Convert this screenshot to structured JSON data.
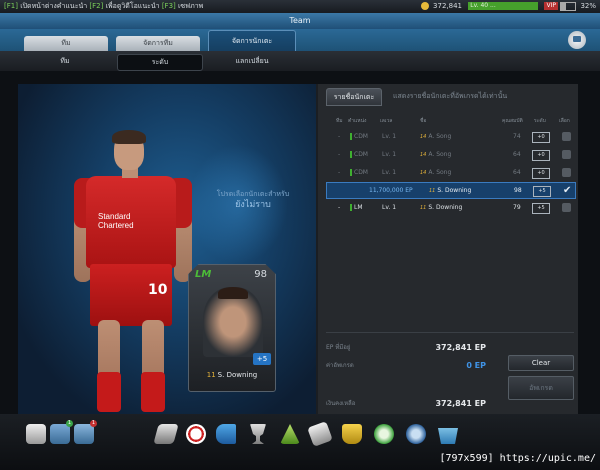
{
  "topbar": {
    "left_prefix_1": "[F1]",
    "left_text_1": "เปิดหน้าต่างคำแนะนำ",
    "left_prefix_2": "[F2]",
    "left_text_2": "เพื่อดูวิดีโอแนะนำ",
    "left_prefix_3": "[F3]",
    "left_text_3": "เซฟภาพ",
    "coins": "372,841",
    "level_text": "Lv. 40 ...",
    "vip": "VIP",
    "battery": "32%"
  },
  "window": {
    "title": "Team"
  },
  "main_tabs": [
    {
      "label": "ทีม"
    },
    {
      "label": "จัดการทีม"
    },
    {
      "label": "จัดการนักเตะ"
    }
  ],
  "sub_tabs": [
    {
      "label": "ทีม"
    },
    {
      "label": "ระดับ"
    },
    {
      "label": "แลกเปลี่ยน"
    }
  ],
  "empty_slot": {
    "line1": "โปรดเลือกนักเตะสำหรับ",
    "line2": "ยังไม่ราบ"
  },
  "player": {
    "sponsor_line1": "Standard",
    "sponsor_line2": "Chartered",
    "shorts_number": "10"
  },
  "card": {
    "position": "LM",
    "overall": "98",
    "plus": "+5",
    "season": "11",
    "name": "S. Downing"
  },
  "panel": {
    "tab_active": "รายชื่อนักเตะ",
    "tab_hint": "แสดงรายชื่อนักเตะที่อัพเกรดได้เท่านั้น",
    "columns": [
      "ทีม",
      "ตำแหน่ง",
      "เลเวล",
      "ชื่อ",
      "คุณสมบัติ",
      "ระดับ",
      "เลือก"
    ],
    "rows": [
      {
        "team": "-",
        "pos": "CDM",
        "level": "Lv. 1",
        "season": "14",
        "name": "A. Song",
        "ovr": "74",
        "plus": "+0",
        "checked": false,
        "state": "dim"
      },
      {
        "team": "-",
        "pos": "CDM",
        "level": "Lv. 1",
        "season": "14",
        "name": "A. Song",
        "ovr": "64",
        "plus": "+0",
        "checked": false,
        "state": "dim"
      },
      {
        "team": "-",
        "pos": "CDM",
        "level": "Lv. 1",
        "season": "14",
        "name": "A. Song",
        "ovr": "64",
        "plus": "+0",
        "checked": false,
        "state": "dim"
      },
      {
        "price": "11,700,000 EP",
        "season": "11",
        "name": "S. Downing",
        "ovr": "98",
        "plus": "+5",
        "checked": true,
        "state": "sel"
      },
      {
        "team": "-",
        "pos": "LM",
        "level": "Lv. 1",
        "season": "11",
        "name": "S. Downing",
        "ovr": "79",
        "plus": "+5",
        "checked": false,
        "state": "bright"
      }
    ],
    "summary": {
      "ep_label": "EP ที่มีอยู่",
      "ep_value": "372,841 EP",
      "cost_label": "ค่าอัพเกรด",
      "cost_value": "0 EP",
      "remain_label": "เงินคงเหลือ",
      "remain_value": "372,841 EP"
    },
    "buttons": {
      "clear": "Clear",
      "upgrade": "อัพเกรด"
    }
  },
  "bottom_badges": {
    "b1": "1",
    "b2": "1"
  },
  "watermark": "[797x599] https://upic.me/"
}
